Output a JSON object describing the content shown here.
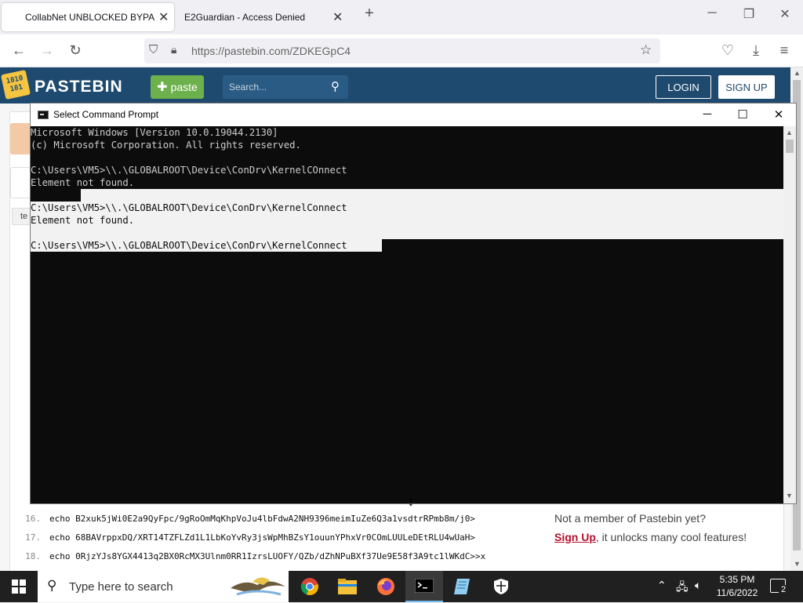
{
  "browser": {
    "tabs": [
      {
        "title": "CollabNet UNBLOCKED BYPASS",
        "active": true
      },
      {
        "title": "E2Guardian - Access Denied",
        "active": false
      }
    ],
    "new_tab_symbol": "+",
    "url": "https://pastebin.com/ZDKEGpC4",
    "controls": {
      "minimize": "─",
      "restore": "❐",
      "close": "✕"
    }
  },
  "pastebin": {
    "logo_text": "PASTEBIN",
    "logo_badge": "1010\n101",
    "paste_button": "paste",
    "search_placeholder": "Search...",
    "login_button": "LOGIN",
    "signup_button": "SIGN UP",
    "code_lines": [
      {
        "num": "16.",
        "text": "echo B2xuk5jWi0E2a9QyFpc/9gRoOmMqKhpVoJu4lbFdwA2NH9396meimIuZe6Q3a1vsdtrRPmb8m/j0>"
      },
      {
        "num": "17.",
        "text": "echo 68BAVrppxDQ/XRT14TZFLZd1L1LbKoYvRy3jsWpMhBZsY1ouunYPhxVr0COmLUULeDEtRLU4wUaH>"
      },
      {
        "num": "18.",
        "text": "echo 0RjzYJs8YGX4413q2BX0RcMX3Ulnm0RR1IzrsLUOFY/QZb/dZhNPuBXf37Ue9E58f3A9tc1lWKdC>>x"
      }
    ],
    "partial_tab_label": "te",
    "promo": {
      "line1": "Not a member of Pastebin yet?",
      "signup_link": "Sign Up",
      "line2_rest": ", it unlocks many cool features!"
    }
  },
  "cmd": {
    "title": "Select Command Prompt",
    "lines": [
      "Microsoft Windows [Version 10.0.19044.2130]",
      "(c) Microsoft Corporation. All rights reserved.",
      "",
      "C:\\Users\\VM5>\\\\.\\GLOBALROOT\\Device\\ConDrv\\KernelCOnnect",
      "Element not found.",
      "",
      "C:\\Users\\VM5>\\\\.\\GLOBALROOT\\Device\\ConDrv\\KernelConnect",
      "Element not found.",
      "",
      "C:\\Users\\VM5>\\\\.\\GLOBALROOT\\Device\\ConDrv\\KernelConnect "
    ]
  },
  "taskbar": {
    "search_placeholder": "Type here to search",
    "time": "5:35 PM",
    "date": "11/6/2022",
    "notification_count": "2",
    "icons": [
      "chrome-icon",
      "file-explorer-icon",
      "firefox-icon",
      "command-prompt-icon",
      "notepad-icon",
      "security-shield-icon"
    ]
  }
}
